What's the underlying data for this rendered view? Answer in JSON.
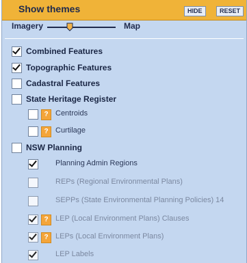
{
  "header": {
    "title": "Show themes",
    "hide_label": "HIDE",
    "reset_label": "RESET"
  },
  "slider": {
    "left_label": "Imagery",
    "right_label": "Map",
    "value": 0.3
  },
  "themes": [
    {
      "label": "Combined Features",
      "checked": true
    },
    {
      "label": "Topographic Features",
      "checked": true
    },
    {
      "label": "Cadastral Features",
      "checked": false
    },
    {
      "label": "State Heritage Register",
      "checked": false,
      "children": [
        {
          "label": "Centroids",
          "checked": false,
          "help": "?"
        },
        {
          "label": "Curtilage",
          "checked": false,
          "help": "?"
        }
      ]
    },
    {
      "label": "NSW Planning",
      "checked": false,
      "children": [
        {
          "label": "Planning Admin Regions",
          "checked": true
        },
        {
          "label": "REPs (Regional Environmental Plans)",
          "checked": false
        },
        {
          "label": "SEPPs (State Environmental Planning Policies) 14",
          "checked": false
        },
        {
          "label": "LEP (Local Environment Plans) Clauses",
          "checked": true,
          "help": "?"
        },
        {
          "label": "LEPs (Local Environment Plans)",
          "checked": true,
          "help": "?"
        },
        {
          "label": "LEP Labels",
          "checked": true
        }
      ]
    }
  ],
  "colors": {
    "header": "#f0b338",
    "panel": "#c4d7f0",
    "help_badge": "#f4a53a"
  }
}
